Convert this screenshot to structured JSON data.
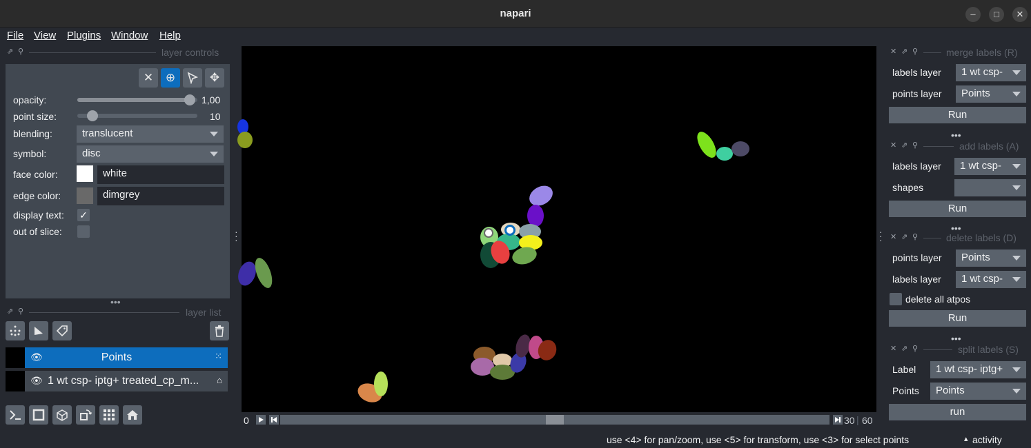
{
  "window": {
    "title": "napari",
    "minimize_icon": "minimize-icon",
    "maximize_icon": "maximize-icon",
    "close_icon": "close-icon"
  },
  "menu": [
    "File",
    "View",
    "Plugins",
    "Window",
    "Help"
  ],
  "layer_controls": {
    "header": "layer controls",
    "mode_buttons": [
      "delete-selected-points",
      "add-points",
      "select-points",
      "pan-zoom"
    ],
    "rows": {
      "opacity": {
        "label": "opacity:",
        "value": "1,00",
        "level": 1.0
      },
      "point_size": {
        "label": "point size:",
        "value": "10",
        "level": 0.1
      },
      "blending": {
        "label": "blending:",
        "value": "translucent"
      },
      "symbol": {
        "label": "symbol:",
        "value": "disc"
      },
      "face_color": {
        "label": "face color:",
        "value": "white",
        "swatch": "#ffffff"
      },
      "edge_color": {
        "label": "edge color:",
        "value": "dimgrey",
        "swatch": "#696969"
      },
      "display_text": {
        "label": "display text:",
        "checked": true
      },
      "out_of_slice": {
        "label": "out of slice:",
        "checked": false
      }
    }
  },
  "layer_list": {
    "header": "layer list",
    "layers": [
      {
        "name": "Points",
        "selected": true,
        "visible": true,
        "type_icon": "points-icon"
      },
      {
        "name": "1 wt csp- iptg+ treated_cp_m...",
        "selected": false,
        "visible": true,
        "type_icon": "label-icon"
      }
    ]
  },
  "dims": {
    "current": "0",
    "ticks": [
      "30",
      "60"
    ]
  },
  "right_docks": {
    "merge": {
      "header": "merge labels (R)",
      "labels_layer_label": "labels layer",
      "labels_layer_value": "1 wt csp-",
      "points_layer_label": "points layer",
      "points_layer_value": "Points",
      "run": "Run"
    },
    "add": {
      "header": "add labels (A)",
      "labels_layer_label": "labels layer",
      "labels_layer_value": "1 wt csp-",
      "shapes_label": "shapes",
      "shapes_value": "",
      "run": "Run"
    },
    "delete": {
      "header": "delete labels (D)",
      "points_layer_label": "points layer",
      "points_layer_value": "Points",
      "labels_layer_label": "labels layer",
      "labels_layer_value": "1 wt csp-",
      "delete_all_label": "delete all atpos",
      "run": "Run"
    },
    "split": {
      "header": "split labels (S)",
      "label_label": "Label",
      "label_value": "1 wt csp- iptg+",
      "points_label": "Points",
      "points_value": "Points",
      "run": "run"
    }
  },
  "status": {
    "hint": "use <4> for pan/zoom, use <5> for transform, use <3> for select points",
    "activity": "activity"
  },
  "colors": {
    "accent": "#0d6dbd",
    "background": "#262930",
    "panel": "#414851"
  }
}
